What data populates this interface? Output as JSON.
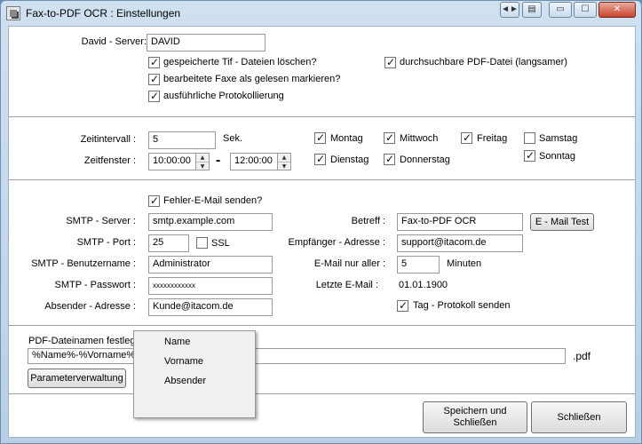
{
  "window": {
    "title": "Fax-to-PDF OCR : Einstellungen",
    "controls": {
      "extra": "◄►",
      "restore_extra": "▤",
      "minimize": "▭",
      "maximize": "☐",
      "close": "✕"
    }
  },
  "server": {
    "label": "David - Server:",
    "value": "DAVID",
    "delete_tif": {
      "label": "gespeicherte Tif - Dateien löschen?",
      "checked": true
    },
    "mark_read": {
      "label": "bearbeitete Faxe als gelesen markieren?",
      "checked": true
    },
    "verbose_log": {
      "label": "ausführliche Protokollierung",
      "checked": true
    },
    "searchable_pdf": {
      "label": "durchsuchbare PDF-Datei (langsamer)",
      "checked": true
    }
  },
  "schedule": {
    "interval_label": "Zeitintervall :",
    "interval_value": "5",
    "interval_unit": "Sek.",
    "window_label": "Zeitfenster :",
    "time_from": "10:00:00",
    "time_dash": "-",
    "time_to": "12:00:00",
    "days": [
      {
        "label": "Montag",
        "checked": true
      },
      {
        "label": "Mittwoch",
        "checked": true
      },
      {
        "label": "Freitag",
        "checked": true
      },
      {
        "label": "Samstag",
        "checked": false
      },
      {
        "label": "Dienstag",
        "checked": true
      },
      {
        "label": "Donnerstag",
        "checked": true
      },
      {
        "label": "Sonntag",
        "checked": true
      }
    ]
  },
  "email": {
    "send_error": {
      "label": "Fehler-E-Mail senden?",
      "checked": true
    },
    "smtp_server_label": "SMTP - Server :",
    "smtp_server": "smtp.example.com",
    "smtp_port_label": "SMTP - Port :",
    "smtp_port": "25",
    "ssl": {
      "label": "SSL",
      "checked": false
    },
    "smtp_user_label": "SMTP - Benutzername :",
    "smtp_user": "Administrator",
    "smtp_pass_label": "SMTP - Passwort :",
    "smtp_pass": "xxxxxxxxxxxx",
    "sender_label": "Absender - Adresse :",
    "sender": "Kunde@itacom.de",
    "subject_label": "Betreff :",
    "subject": "Fax-to-PDF OCR",
    "test_button": "E - Mail Test",
    "recipient_label": "Empfänger - Adresse :",
    "recipient": "support@itacom.de",
    "every_label": "E-Mail nur aller :",
    "every_value": "5",
    "every_unit": "Minuten",
    "last_label": "Letzte E-Mail :",
    "last_value": "01.01.1900",
    "daily_log": {
      "label": "Tag - Protokoll senden",
      "checked": true
    }
  },
  "pdf": {
    "label": "PDF-Dateinamen festlegen:",
    "pattern": "%Name%-%Vorname%",
    "extension": ".pdf",
    "param_button": "Parameterverwaltung",
    "menu": [
      "Name",
      "Vorname",
      "Absender"
    ]
  },
  "footer": {
    "save_close": "Speichern und Schließen",
    "close": "Schließen"
  }
}
